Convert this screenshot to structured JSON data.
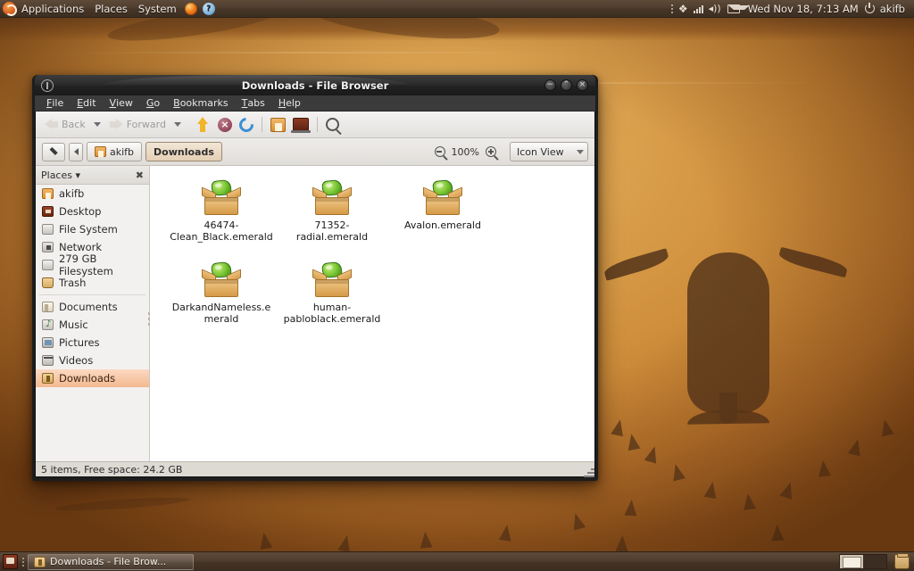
{
  "top_panel": {
    "menus": [
      "Applications",
      "Places",
      "System"
    ],
    "launchers": [
      {
        "name": "firefox-icon",
        "glyph": ""
      },
      {
        "name": "help-icon",
        "glyph": "?"
      }
    ],
    "tray": {
      "bluetooth_icon": "✶",
      "signal_icon": "signal-bars",
      "volume_icon": "◂))",
      "mail_icon": "envelope",
      "clock": "Wed Nov 18,  7:13 AM",
      "power_icon": "power",
      "user": "akifb"
    }
  },
  "window": {
    "title": "Downloads - File Browser",
    "controls": {
      "minimize": "−",
      "maximize": "⌃",
      "close": "×"
    },
    "menubar": [
      {
        "pre": "",
        "mn": "F",
        "post": "ile"
      },
      {
        "pre": "",
        "mn": "E",
        "post": "dit"
      },
      {
        "pre": "",
        "mn": "V",
        "post": "iew"
      },
      {
        "pre": "",
        "mn": "G",
        "post": "o"
      },
      {
        "pre": "",
        "mn": "B",
        "post": "ookmarks"
      },
      {
        "pre": "",
        "mn": "T",
        "post": "abs"
      },
      {
        "pre": "",
        "mn": "H",
        "post": "elp"
      }
    ],
    "toolbar": {
      "back_label": "Back",
      "forward_label": "Forward",
      "up_icon": "up-arrow-icon",
      "stop_icon": "stop-icon",
      "stop_glyph": "×",
      "reload_icon": "reload-icon",
      "home_icon": "home-icon",
      "computer_icon": "computer-icon",
      "search_icon": "search-icon"
    },
    "pathbar": {
      "edit_location_icon": "pencil-icon",
      "prev_crumb_icon": "chevron-left-icon",
      "crumbs": [
        {
          "label": "akifb",
          "active": false
        },
        {
          "label": "Downloads",
          "active": true
        }
      ],
      "zoom_out_icon": "zoom-out-icon",
      "zoom_level": "100%",
      "zoom_in_icon": "zoom-in-icon",
      "view_mode": "Icon View"
    },
    "sidebar": {
      "header": "Places ▾",
      "close_icon": "✖",
      "items": [
        {
          "label": "akifb",
          "icon": "home-icon",
          "cls": "i-home",
          "selected": false
        },
        {
          "label": "Desktop",
          "icon": "desktop-icon",
          "cls": "i-desktop",
          "selected": false
        },
        {
          "label": "File System",
          "icon": "disk-icon",
          "cls": "i-disk",
          "selected": false
        },
        {
          "label": "Network",
          "icon": "network-icon",
          "cls": "i-net",
          "selected": false
        },
        {
          "label": "279 GB Filesystem",
          "icon": "disk-icon",
          "cls": "i-disk",
          "selected": false
        },
        {
          "label": "Trash",
          "icon": "trash-icon",
          "cls": "i-trash",
          "selected": false
        },
        {
          "label": "Documents",
          "icon": "documents-icon",
          "cls": "i-docs",
          "selected": false,
          "sep_before": true
        },
        {
          "label": "Music",
          "icon": "music-icon",
          "cls": "i-music",
          "selected": false
        },
        {
          "label": "Pictures",
          "icon": "pictures-icon",
          "cls": "i-pics",
          "selected": false
        },
        {
          "label": "Videos",
          "icon": "videos-icon",
          "cls": "i-vids",
          "selected": false
        },
        {
          "label": "Downloads",
          "icon": "downloads-icon",
          "cls": "i-dl",
          "selected": true
        }
      ]
    },
    "files": [
      {
        "name": "46474-Clean_Black.emerald",
        "icon": "emerald-theme-icon"
      },
      {
        "name": "71352-radial.emerald",
        "icon": "emerald-theme-icon"
      },
      {
        "name": "Avalon.emerald",
        "icon": "emerald-theme-icon"
      },
      {
        "name": "DarkandNameless.emerald",
        "icon": "emerald-theme-icon"
      },
      {
        "name": "human-pabloblack.emerald",
        "icon": "emerald-theme-icon"
      }
    ],
    "statusbar": "5 items, Free space: 24.2 GB"
  },
  "bottom_panel": {
    "show_desktop_icon": "show-desktop-icon",
    "window_button": "Downloads - File Brow...",
    "workspaces": [
      {
        "active": true
      },
      {
        "active": false
      }
    ],
    "trash_icon": "trash-icon"
  },
  "colors": {
    "accent": "#dd8f2e",
    "desktop_base": "#cf8f3c",
    "panel": "#4e3d2e",
    "selection": "#f3b98f"
  }
}
